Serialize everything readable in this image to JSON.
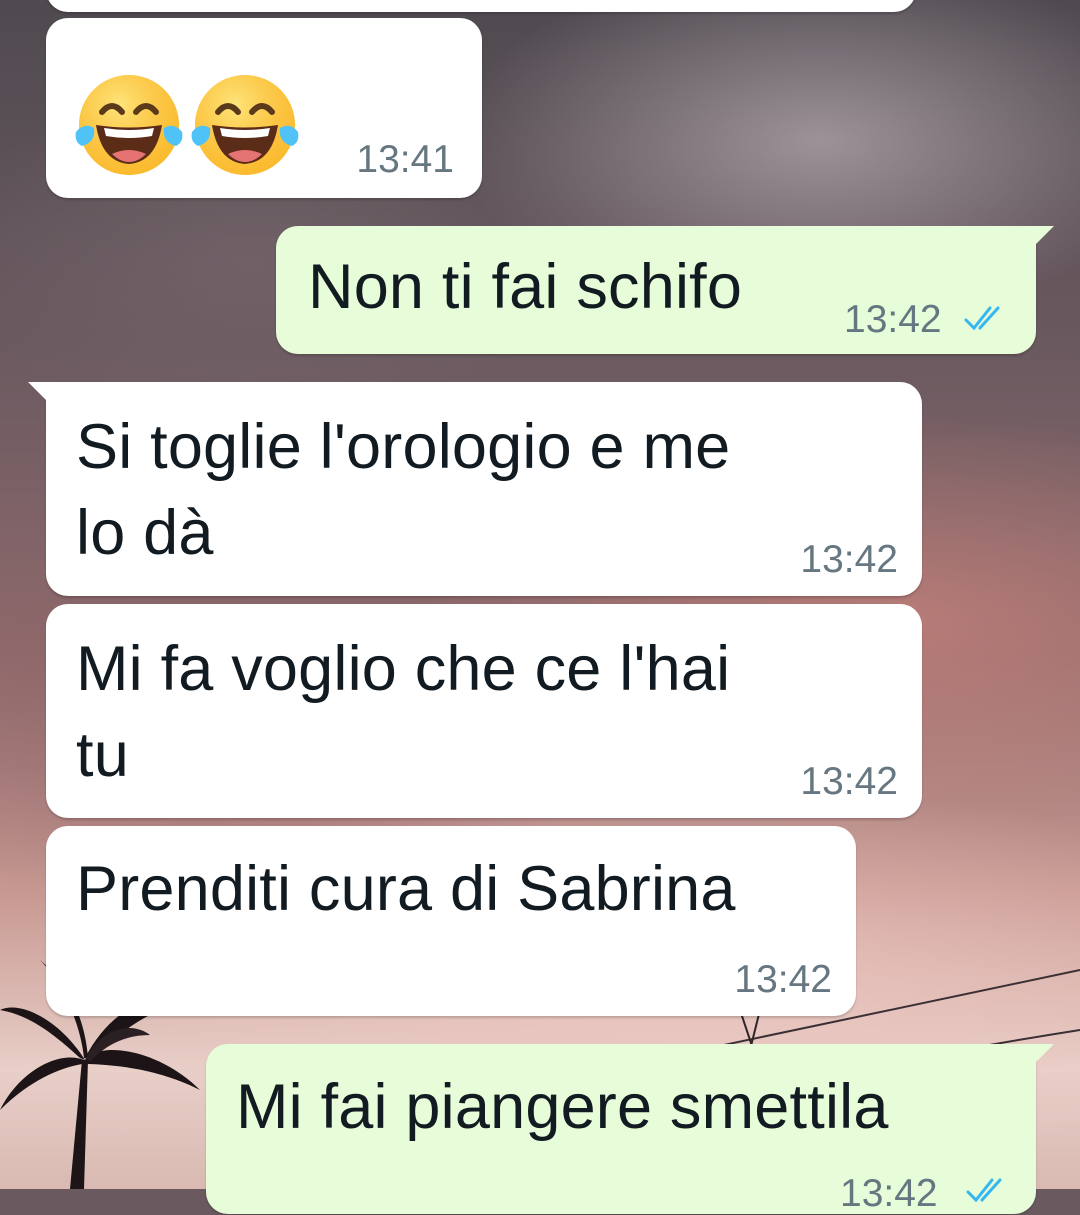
{
  "chat": {
    "messages": [
      {
        "direction": "in",
        "emojis": [
          "tears-of-joy-icon",
          "tears-of-joy-icon"
        ],
        "time": "13:41"
      },
      {
        "direction": "out",
        "text": "Non ti fai schifo",
        "time": "13:42",
        "status": "read"
      },
      {
        "direction": "in",
        "text": "Si toglie l'orologio e me\nlo dà",
        "time": "13:42"
      },
      {
        "direction": "in",
        "text": "Mi fa voglio che ce l'hai\ntu",
        "time": "13:42"
      },
      {
        "direction": "in",
        "text": "Prenditi cura di Sabrina",
        "time": "13:42"
      },
      {
        "direction": "out",
        "text": "Mi fai piangere smettila",
        "time": "13:42",
        "status": "read"
      }
    ]
  },
  "colors": {
    "incoming_bubble": "#ffffff",
    "outgoing_bubble": "#e7fcd8",
    "timestamp": "#667781",
    "read_ticks": "#34b7f1"
  }
}
